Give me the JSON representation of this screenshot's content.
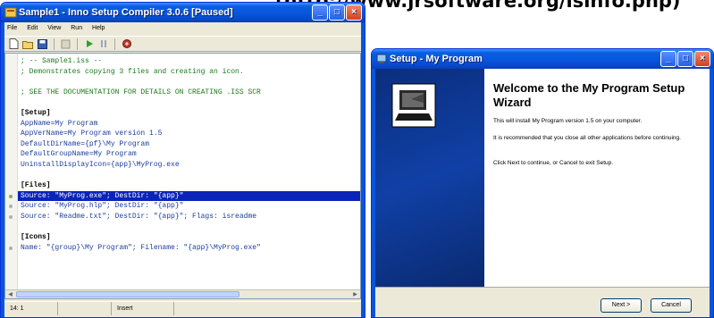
{
  "caption": "(http://www.jrsoftware.org/isinfo.php)",
  "inno": {
    "title": "Sample1 - Inno Setup Compiler 3.0.6  [Paused]",
    "menu": [
      "File",
      "Edit",
      "View",
      "Run",
      "Help"
    ],
    "code": [
      {
        "text": "; -- Sample1.iss --",
        "cls": "c-com"
      },
      {
        "text": "; Demonstrates copying 3 files and creating an icon.",
        "cls": "c-com"
      },
      {
        "text": "",
        "cls": ""
      },
      {
        "text": "; SEE THE DOCUMENTATION FOR DETAILS ON CREATING .ISS SCR",
        "cls": "c-com"
      },
      {
        "text": "",
        "cls": ""
      },
      {
        "text": "[Setup]",
        "cls": "c-sec"
      },
      {
        "text": "AppName=My Program",
        "cls": "c-key"
      },
      {
        "text": "AppVerName=My Program version 1.5",
        "cls": "c-key"
      },
      {
        "text": "DefaultDirName={pf}\\My Program",
        "cls": "c-key"
      },
      {
        "text": "DefaultGroupName=My Program",
        "cls": "c-key"
      },
      {
        "text": "UninstallDisplayIcon={app}\\MyProg.exe",
        "cls": "c-key"
      },
      {
        "text": "",
        "cls": ""
      },
      {
        "text": "[Files]",
        "cls": "c-sec"
      },
      {
        "text": "Source: \"MyProg.exe\"; DestDir: \"{app}\"",
        "cls": "sel",
        "dot": "g"
      },
      {
        "text": "Source: \"MyProg.hlp\"; DestDir: \"{app}\"",
        "cls": "c-key",
        "dot": "x"
      },
      {
        "text": "Source: \"Readme.txt\"; DestDir: \"{app}\"; Flags: isreadme",
        "cls": "c-key",
        "dot": "x"
      },
      {
        "text": "",
        "cls": ""
      },
      {
        "text": "[Icons]",
        "cls": "c-sec"
      },
      {
        "text": "Name: \"{group}\\My Program\"; Filename: \"{app}\\MyProg.exe\"",
        "cls": "c-key",
        "dot": "x"
      }
    ],
    "status": {
      "position": "14:  1",
      "mode": "Insert"
    }
  },
  "setup": {
    "title": "Setup - My Program",
    "heading": "Welcome to the My Program Setup Wizard",
    "p1": "This will install My Program version 1.5 on your computer.",
    "p2": "It is recommended that you close all other applications before continuing.",
    "p3": "Click Next to continue, or Cancel to exit Setup.",
    "next_label": "Next >",
    "cancel_label": "Cancel"
  },
  "colors": {
    "xp_blue": "#0855dd",
    "selection": "#0a24b8",
    "wizard_panel": "#1040a6"
  }
}
